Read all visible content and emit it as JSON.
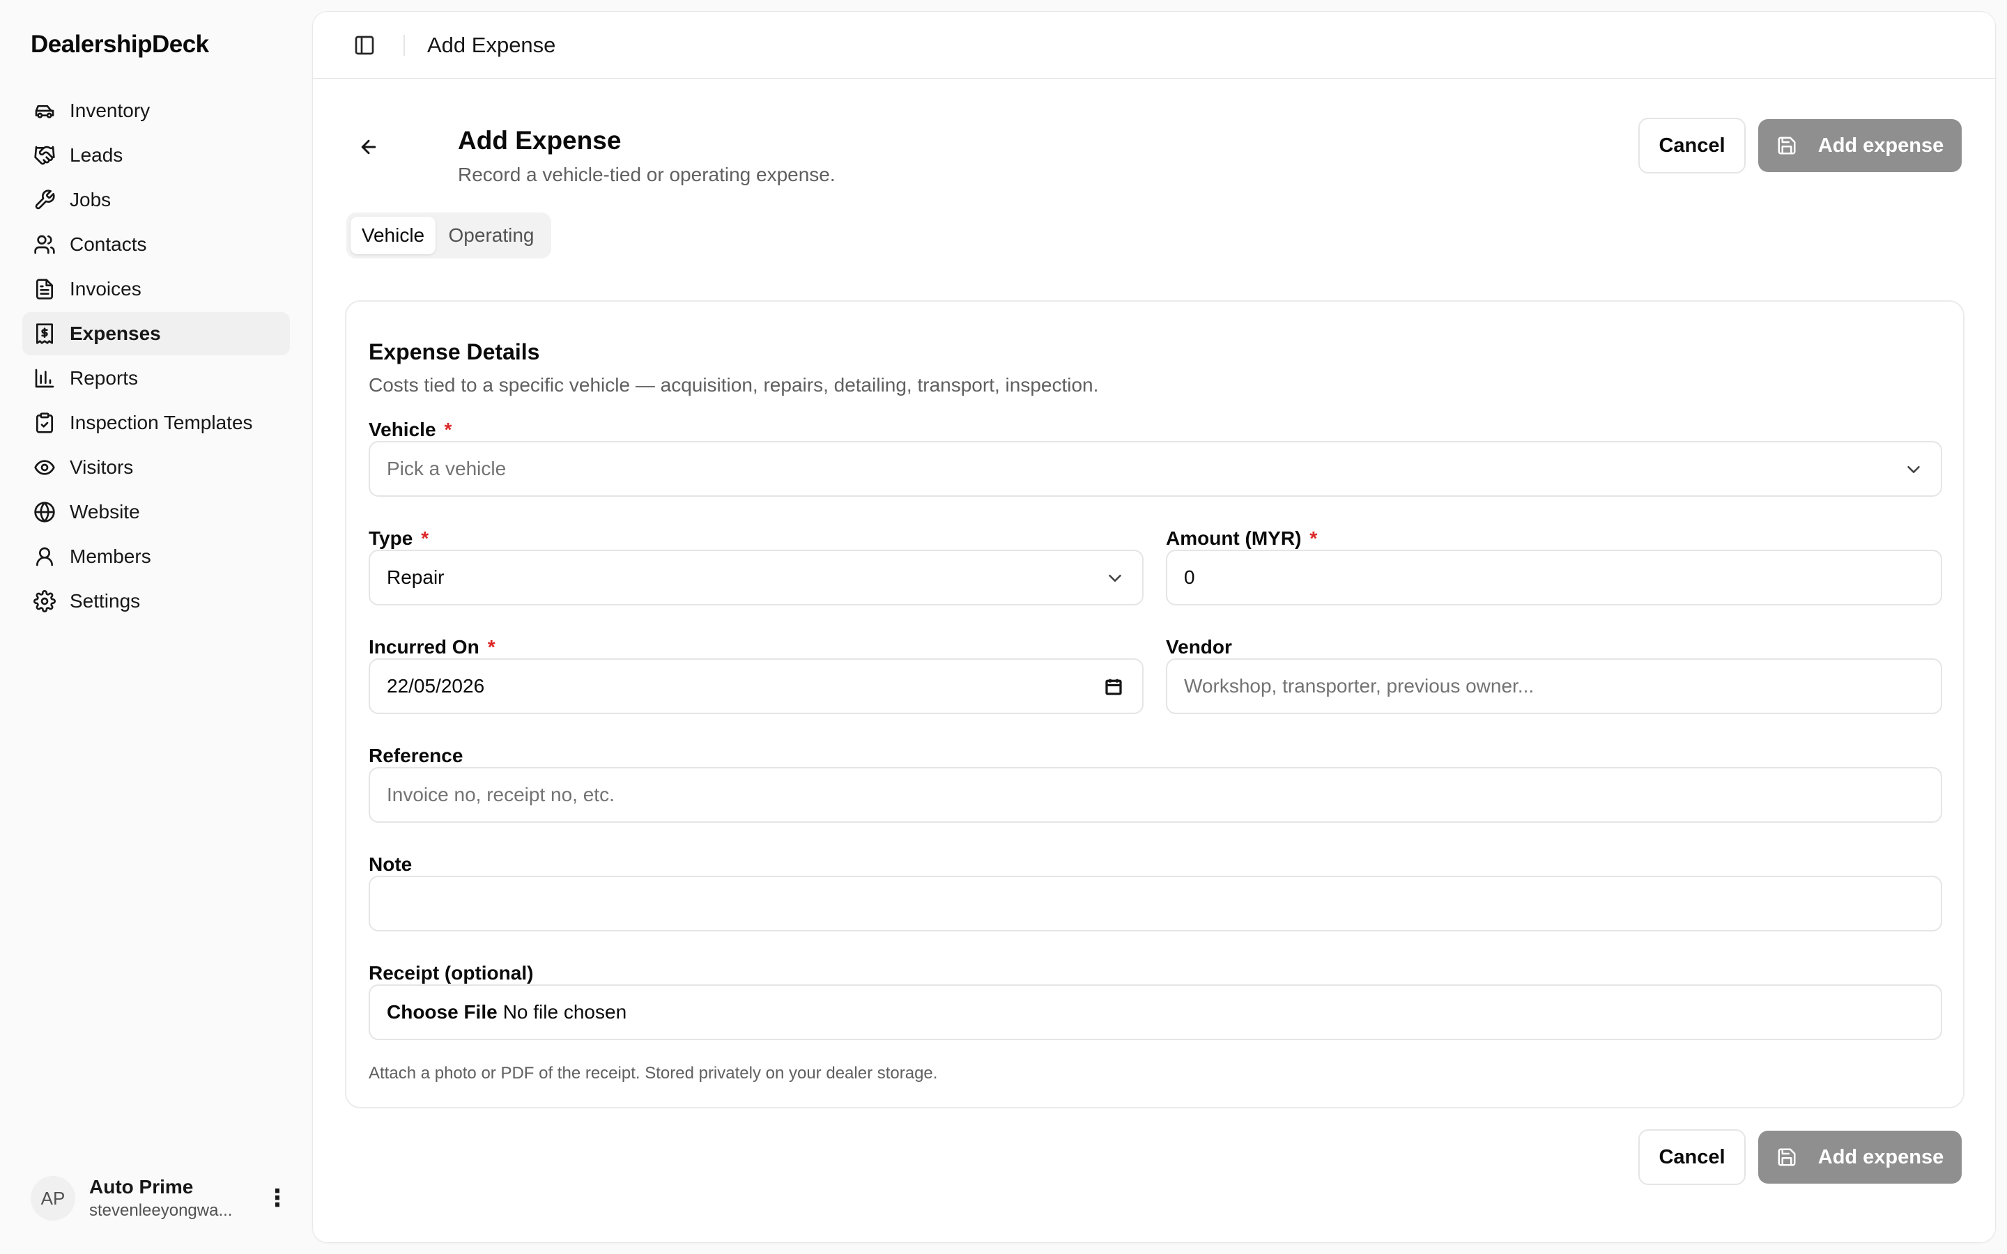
{
  "app": {
    "brand": "DealershipDeck"
  },
  "sidebar": {
    "items": [
      {
        "label": "Inventory",
        "icon": "car-icon"
      },
      {
        "label": "Leads",
        "icon": "handshake-icon"
      },
      {
        "label": "Jobs",
        "icon": "wrench-icon"
      },
      {
        "label": "Contacts",
        "icon": "users-icon"
      },
      {
        "label": "Invoices",
        "icon": "file-text-icon"
      },
      {
        "label": "Expenses",
        "icon": "receipt-icon",
        "active": true
      },
      {
        "label": "Reports",
        "icon": "bar-chart-icon"
      },
      {
        "label": "Inspection Templates",
        "icon": "clipboard-check-icon"
      },
      {
        "label": "Visitors",
        "icon": "eye-icon"
      },
      {
        "label": "Website",
        "icon": "globe-icon"
      },
      {
        "label": "Members",
        "icon": "user-icon"
      },
      {
        "label": "Settings",
        "icon": "gear-icon"
      }
    ]
  },
  "user": {
    "initials": "AP",
    "name": "Auto Prime",
    "email": "stevenleeyongwa..."
  },
  "topbar": {
    "title": "Add Expense"
  },
  "header": {
    "title": "Add Expense",
    "subtitle": "Record a vehicle-tied or operating expense.",
    "cancel_label": "Cancel",
    "add_label": "Add expense"
  },
  "tabs": [
    {
      "label": "Vehicle",
      "active": true
    },
    {
      "label": "Operating",
      "active": false
    }
  ],
  "form": {
    "title": "Expense Details",
    "description": "Costs tied to a specific vehicle — acquisition, repairs, detailing, transport, inspection.",
    "required_marker": "*",
    "vehicle": {
      "label": "Vehicle",
      "placeholder": "Pick a vehicle"
    },
    "type": {
      "label": "Type",
      "value": "Repair"
    },
    "amount": {
      "label": "Amount (MYR)",
      "value": "0"
    },
    "incurred_on": {
      "label": "Incurred On",
      "value": "22/05/2026"
    },
    "vendor": {
      "label": "Vendor",
      "placeholder": "Workshop, transporter, previous owner..."
    },
    "reference": {
      "label": "Reference",
      "placeholder": "Invoice no, receipt no, etc."
    },
    "note": {
      "label": "Note",
      "value": ""
    },
    "receipt": {
      "label": "Receipt (optional)",
      "choose_label": "Choose File",
      "status": "No file chosen",
      "hint": "Attach a photo or PDF of the receipt. Stored privately on your dealer storage."
    }
  },
  "footer": {
    "cancel_label": "Cancel",
    "add_label": "Add expense"
  },
  "colors": {
    "primary_disabled": "#8f8f8f",
    "required": "#dc2626",
    "active_nav_bg": "#f0f0f0"
  }
}
